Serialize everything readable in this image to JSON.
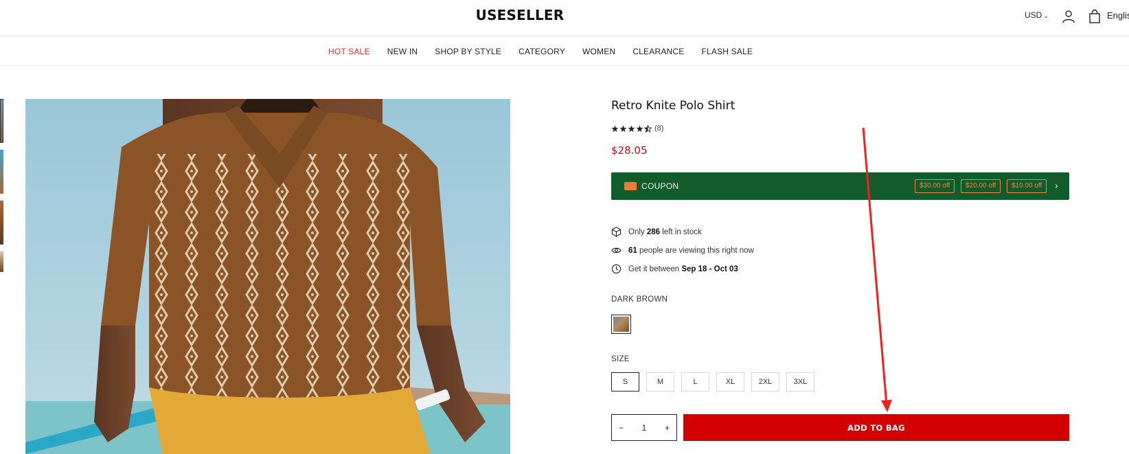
{
  "header": {
    "logo": "USESELLER",
    "currency": "USD",
    "language": "Englis"
  },
  "nav": {
    "items": [
      {
        "label": "HOT SALE"
      },
      {
        "label": "NEW IN"
      },
      {
        "label": "SHOP BY STYLE"
      },
      {
        "label": "CATEGORY"
      },
      {
        "label": "WOMEN"
      },
      {
        "label": "CLEARANCE"
      },
      {
        "label": "FLASH SALE"
      }
    ]
  },
  "product": {
    "title": "Retro Knite Polo Shirt",
    "rating": 4.5,
    "review_count": "(8)",
    "price": "$28.05",
    "coupon": {
      "label": "COUPON",
      "offers": [
        "$30.00 off",
        "$20.00 off",
        "$10.00 off"
      ]
    },
    "info": {
      "stock_pre": "Only",
      "stock_count": "286",
      "stock_post": "left in stock",
      "viewers_count": "61",
      "viewers_post": "people are viewing this right now",
      "delivery_pre": "Get it between",
      "delivery_range": "Sep 18 - Oct 03"
    },
    "color_label": "DARK BROWN",
    "size_label": "SIZE",
    "sizes": [
      "S",
      "M",
      "L",
      "XL",
      "2XL",
      "3XL"
    ],
    "selected_size": "S",
    "quantity": "1",
    "add_to_bag": "ADD TO BAG"
  },
  "colors": {
    "accent_red": "#d20000",
    "hot_sale": "#e03131",
    "coupon_green": "#115c2a",
    "coupon_orange": "#f08c3c"
  }
}
